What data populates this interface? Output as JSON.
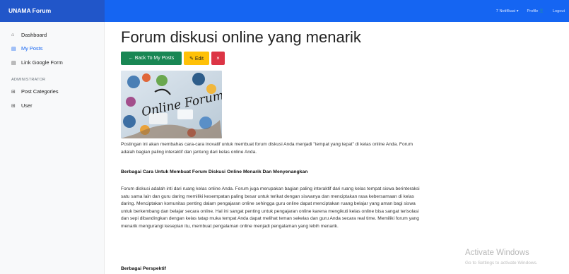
{
  "brand": "UNAMA Forum",
  "navbar": {
    "notifications": "7 Notifikasi ▾",
    "profile": "Profile 👤",
    "logout": "Logout"
  },
  "sidebar": {
    "items": [
      {
        "label": "Dashboard",
        "icon": "home-icon"
      },
      {
        "label": "My Posts",
        "icon": "document-icon",
        "active": true
      },
      {
        "label": "Link Google Form",
        "icon": "document-icon"
      }
    ],
    "admin_heading": "ADMINISTRATOR",
    "admin_items": [
      {
        "label": "Post Categories",
        "icon": "grid-icon"
      },
      {
        "label": "User",
        "icon": "grid-icon"
      }
    ]
  },
  "post": {
    "title": "Forum diskusi online yang menarik",
    "back_label": "← Back To My Posts",
    "edit_label": "✎ Edit",
    "delete_label": "×",
    "image_text": "Online Forum",
    "intro": "Postingan ini akan membahas cara-cara inovatif untuk membuat forum diskusi Anda menjadi \"tempat yang tepat\" di kelas online Anda. Forum adalah bagian paling interaktif dan jantung dari kelas online Anda.",
    "heading1": "Berbagai Cara Untuk Membuat Forum Diskusi Online Menarik Dan Menyenangkan",
    "body1": "Forum diskusi adalah inti dari ruang kelas online Anda. Forum juga merupakan bagian paling interaktif dari ruang kelas tempat siswa berinteraksi satu sama lain dan guru daring memiliki kesempatan paling besar untuk terikat dengan siswanya dan menciptakan rasa kebersamaan di kelas daring. Menciptakan komunitas penting dalam pengajaran online sehingga guru online dapat menciptakan ruang belajar yang aman bagi siswa untuk berkembang dan belajar secara online. Hal ini sangat penting untuk pengajaran online karena mengikuti kelas online bisa sangat terisolasi dan sepi dibandingkan dengan kelas tatap muka tempat Anda dapat melihat teman sekelas dan guru Anda secara real time. Memiliki forum yang menarik mengurangi kesepian itu, membuat pengalaman online menjadi pengalaman yang lebih menarik.",
    "heading2": "Berbagai Perspektif"
  },
  "watermark": {
    "title": "Activate Windows",
    "subtitle": "Go to Settings to activate Windows."
  }
}
